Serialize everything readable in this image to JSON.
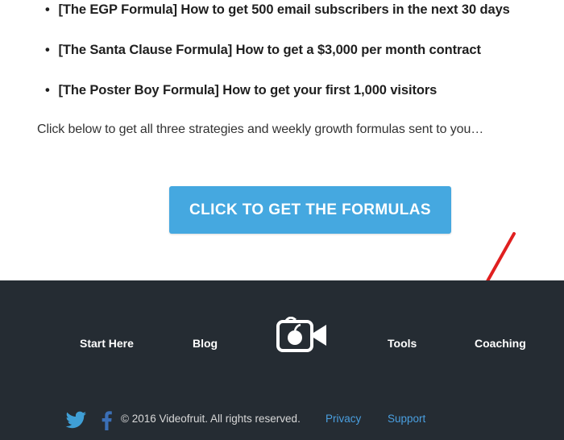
{
  "bullets": [
    "[The EGP Formula] How to get 500 email subscribers in the next 30 days",
    "[The Santa Clause Formula] How to get a $3,000 per month contract",
    "[The Poster Boy Formula] How to get your first 1,000 visitors"
  ],
  "intro": "Click below to get all three strategies and weekly growth formulas sent to you…",
  "cta": {
    "label": "CLICK TO GET THE FORMULAS",
    "color": "#45a8e0"
  },
  "annotation": {
    "icon": "red-arrow-icon",
    "color": "#e02020"
  },
  "footer": {
    "background": "#252c33",
    "nav": [
      "Start Here",
      "Blog",
      "Tools",
      "Coaching"
    ],
    "logo_icon": "videofruit-camera-apple-logo",
    "social": [
      "twitter-icon",
      "facebook-icon"
    ],
    "copyright": "© 2016 Videofruit. All rights reserved.",
    "links": [
      "Privacy",
      "Support"
    ],
    "link_color": "#4a9fe0"
  }
}
